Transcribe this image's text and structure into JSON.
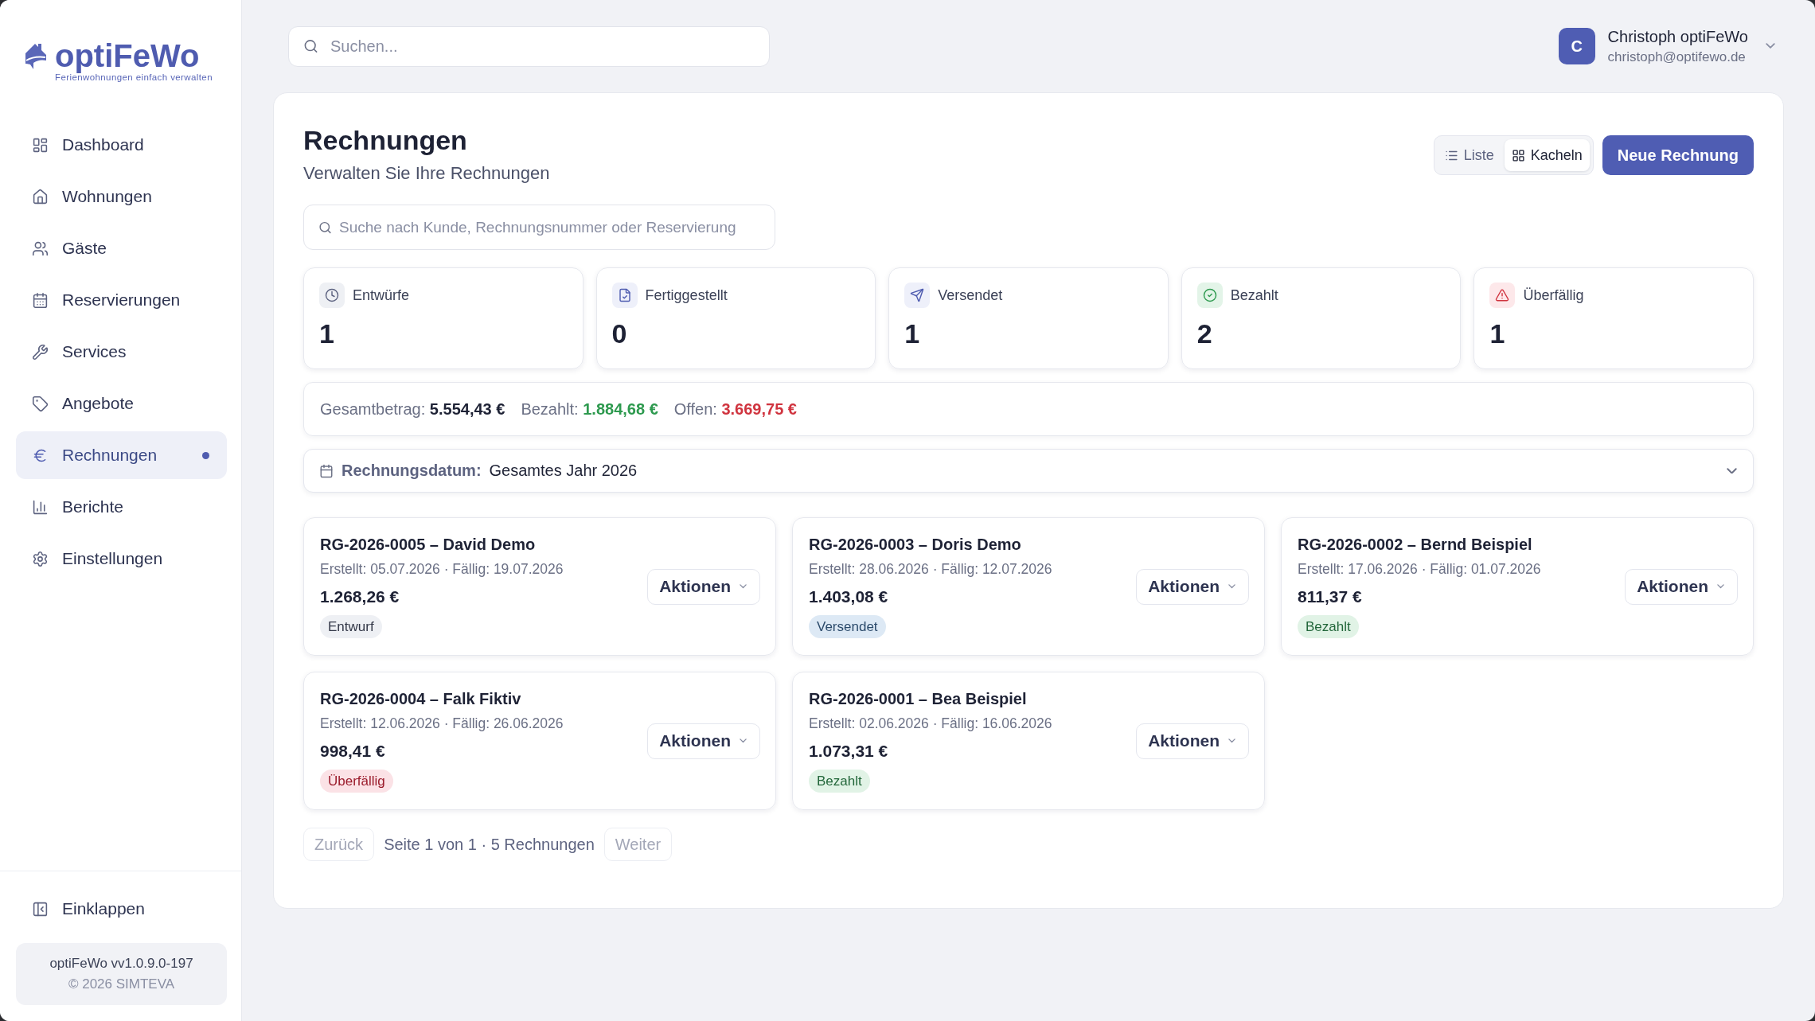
{
  "sidebar": {
    "logo": {
      "name": "optiFeWo",
      "tagline": "Ferienwohnungen einfach verwalten"
    },
    "items": [
      {
        "label": "Dashboard",
        "kind": "dashboard",
        "selected": false
      },
      {
        "label": "Wohnungen",
        "kind": "home",
        "selected": false
      },
      {
        "label": "Gäste",
        "kind": "guests",
        "selected": false
      },
      {
        "label": "Reservierungen",
        "kind": "calendar",
        "selected": false
      },
      {
        "label": "Services",
        "kind": "services",
        "selected": false
      },
      {
        "label": "Angebote",
        "kind": "offers",
        "selected": false
      },
      {
        "label": "Rechnungen",
        "kind": "invoices",
        "selected": true
      },
      {
        "label": "Berichte",
        "kind": "reports",
        "selected": false
      },
      {
        "label": "Einstellungen",
        "kind": "settings",
        "selected": false
      }
    ],
    "collapse_label": "Einklappen",
    "version": "optiFeWo vv1.0.9.0-197",
    "copyright": "© 2026 SIMTEVA"
  },
  "header": {
    "search": {
      "placeholder": "Suchen..."
    },
    "user": {
      "initial": "C",
      "name": "Christoph optiFeWo",
      "email": "christoph@optifewo.de"
    }
  },
  "page": {
    "title": "Rechnungen",
    "subtitle": "Verwalten Sie Ihre Rechnungen",
    "view_toggle": [
      {
        "label": "Liste",
        "kind": "list",
        "selected": false
      },
      {
        "label": "Kacheln",
        "kind": "grid",
        "selected": true
      }
    ],
    "new_button": "Neue Rechnung",
    "search": {
      "placeholder": "Suche nach Kunde, Rechnungsnummer oder Reservierung"
    },
    "stats": [
      {
        "label": "Entwürfe",
        "value": "1",
        "kind": "draft"
      },
      {
        "label": "Fertiggestellt",
        "value": "0",
        "kind": "done"
      },
      {
        "label": "Versendet",
        "value": "1",
        "kind": "sent"
      },
      {
        "label": "Bezahlt",
        "value": "2",
        "kind": "paid"
      },
      {
        "label": "Überfällig",
        "value": "1",
        "kind": "overdue"
      }
    ],
    "summary": [
      {
        "label": "Gesamtbetrag:",
        "value": "5.554,43 €",
        "kind": "total"
      },
      {
        "label": "Bezahlt:",
        "value": "1.884,68 €",
        "kind": "paid"
      },
      {
        "label": "Offen:",
        "value": "3.669,75 €",
        "kind": "open"
      }
    ],
    "date_filter": {
      "label": "Rechnungsdatum:",
      "value": "Gesamtes Jahr 2026"
    },
    "invoices": [
      {
        "title": "RG-2026-0005 – David Demo",
        "dates": "Erstellt: 05.07.2026 · Fällig: 19.07.2026",
        "amount": "1.268,26 €",
        "status": {
          "label": "Entwurf",
          "kind": "draft"
        },
        "action_label": "Aktionen"
      },
      {
        "title": "RG-2026-0003 – Doris Demo",
        "dates": "Erstellt: 28.06.2026 · Fällig: 12.07.2026",
        "amount": "1.403,08 €",
        "status": {
          "label": "Versendet",
          "kind": "sent"
        },
        "action_label": "Aktionen"
      },
      {
        "title": "RG-2026-0002 – Bernd Beispiel",
        "dates": "Erstellt: 17.06.2026 · Fällig: 01.07.2026",
        "amount": "811,37 €",
        "status": {
          "label": "Bezahlt",
          "kind": "paid"
        },
        "action_label": "Aktionen"
      },
      {
        "title": "RG-2026-0004 – Falk Fiktiv",
        "dates": "Erstellt: 12.06.2026 · Fällig: 26.06.2026",
        "amount": "998,41 €",
        "status": {
          "label": "Überfällig",
          "kind": "overdue"
        },
        "action_label": "Aktionen"
      },
      {
        "title": "RG-2026-0001 – Bea Beispiel",
        "dates": "Erstellt: 02.06.2026 · Fällig: 16.06.2026",
        "amount": "1.073,31 €",
        "status": {
          "label": "Bezahlt",
          "kind": "paid"
        },
        "action_label": "Aktionen"
      }
    ],
    "pagination": {
      "previous": {
        "label": "Zurück",
        "disabled": true
      },
      "info": "Seite 1 von 1 · 5 Rechnungen",
      "next": {
        "label": "Weiter",
        "disabled": true
      }
    }
  }
}
